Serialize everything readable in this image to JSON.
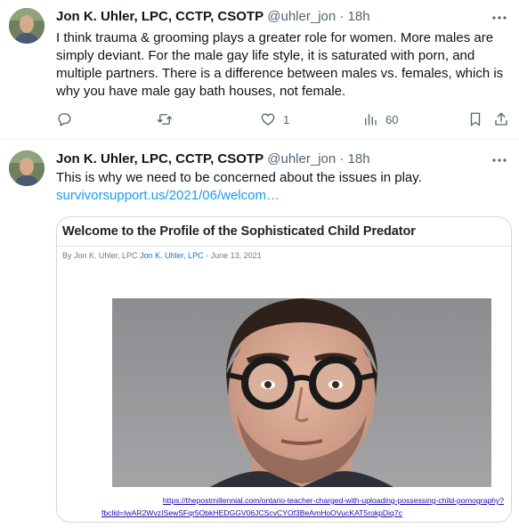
{
  "tweets": [
    {
      "author_name": "Jon K. Uhler, LPC, CCTP, CSOTP",
      "handle": "@uhler_jon",
      "separator": "·",
      "time": "18h",
      "text": "I think trauma & grooming plays a greater role for women. More males are simply deviant. For the male gay life style, it is saturated with porn, and multiple partners. There is a difference between males vs. females, which is why you have male gay bath houses, not female.",
      "actions": {
        "reply_count": "",
        "retweet_count": "",
        "like_count": "1",
        "views_count": "60"
      }
    },
    {
      "author_name": "Jon K. Uhler, LPC, CCTP, CSOTP",
      "handle": "@uhler_jon",
      "separator": "·",
      "time": "18h",
      "text": "This is why we need to be concerned about the issues in play.",
      "link": "survivorsupport.us/2021/06/welcom…",
      "card": {
        "title": "Welcome to the Profile of the Sophisticated Child Predator",
        "byline_prefix": "By Jon K. Uhler, LPC",
        "byline_author": "Jon K. Uhler, LPC",
        "byline_date": "- June 13, 2021",
        "url_line1": "https://thepostmillennial.com/ontario-teacher-charged-with-uploading-possessing-child-pornography?",
        "url_line2": "fbclid=IwAR2WvzISewSFqr5ObkHEDGGV06JCScvCYOf3BeAmHoOVucKAT5rokpDiq7c"
      }
    }
  ],
  "icons": {
    "more": "more-horizontal-icon",
    "reply": "reply-icon",
    "retweet": "retweet-icon",
    "like": "heart-icon",
    "views": "views-bar-chart-icon",
    "bookmark": "bookmark-icon",
    "share": "share-icon"
  },
  "colors": {
    "text_primary": "#0f1419",
    "text_secondary": "#536471",
    "link": "#1d9bf0",
    "divider": "#eff3f4",
    "card_border": "#cfd9de"
  }
}
